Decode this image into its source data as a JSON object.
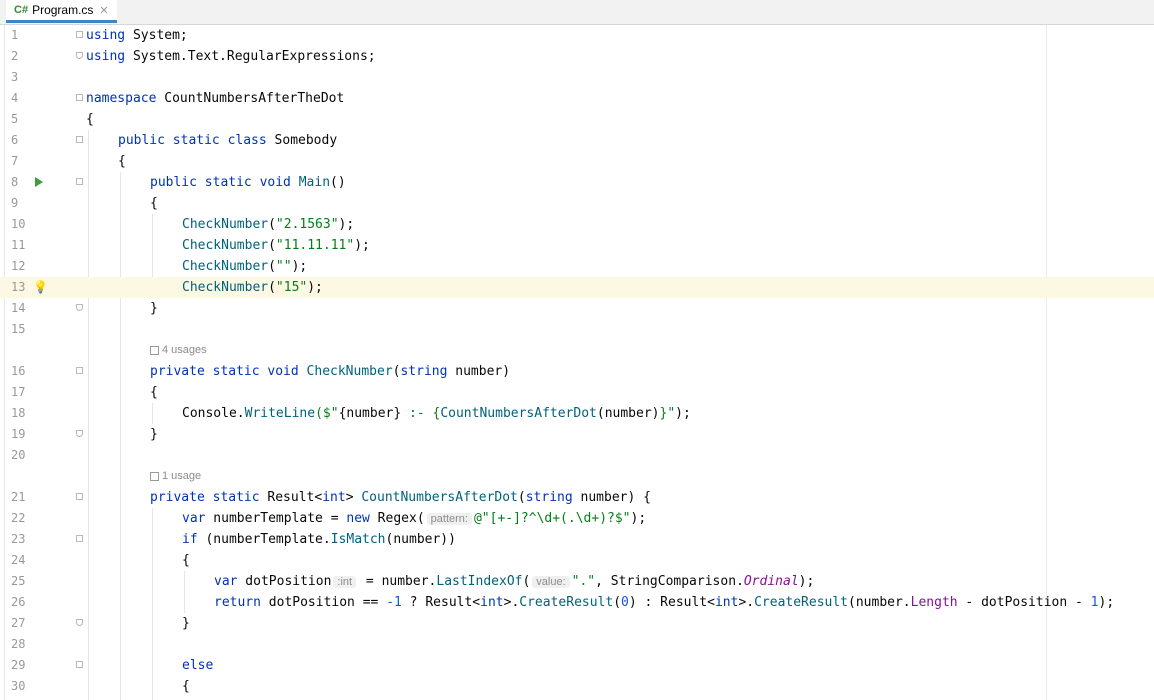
{
  "tab": {
    "lang": "C#",
    "name": "Program.cs",
    "close": "✕"
  },
  "lines": {
    "n1": "1",
    "n2": "2",
    "n3": "3",
    "n4": "4",
    "n5": "5",
    "n6": "6",
    "n7": "7",
    "n8": "8",
    "n9": "9",
    "n10": "10",
    "n11": "11",
    "n12": "12",
    "n13": "13",
    "n14": "14",
    "n15": "15",
    "n16": "16",
    "n17": "17",
    "n18": "18",
    "n19": "19",
    "n20": "20",
    "n21": "21",
    "n22": "22",
    "n23": "23",
    "n24": "24",
    "n25": "25",
    "n26": "26",
    "n27": "27",
    "n28": "28",
    "n29": "29",
    "n30": "30"
  },
  "code": {
    "l1_kw": "using",
    "l1_rest": " System;",
    "l2_kw": "using",
    "l2_rest": " System.Text.RegularExpressions;",
    "l4_kw": "namespace",
    "l4_rest": " CountNumbersAfterTheDot",
    "l5": "{",
    "l6_kw": "public static class",
    "l6_rest": " Somebody",
    "l7": "{",
    "l8_kw": "public static void",
    "l8_m": "Main",
    "l8_rest": "()",
    "l9": "{",
    "l10_m": "CheckNumber",
    "l10_s": "\"2.1563\"",
    "l10_end": ");",
    "l11_m": "CheckNumber",
    "l11_s": "\"11.11.11\"",
    "l11_end": ");",
    "l12_m": "CheckNumber",
    "l12_s": "\"\"",
    "l12_end": ");",
    "l13_m": "CheckNumber",
    "l13_s": "\"15\"",
    "l13_end": ");",
    "l14": "}",
    "usages_a": "4 usages",
    "l16_kw": "private static void",
    "l16_m": "CheckNumber",
    "l16_kw2": "string",
    "l16_rest": " number)",
    "l17": "{",
    "l18_a": "Console.",
    "l18_m": "WriteLine",
    "l18_b": "($\"",
    "l18_c": "{number}",
    "l18_s": " :- ",
    "l18_d": "{",
    "l18_m2": "CountNumbersAfterDot",
    "l18_e": "(number)",
    "l18_f": "}",
    "l18_g": "\"",
    "l18_h": ");",
    "l19": "}",
    "usages_b": "1 usage",
    "l21_kw": "private static",
    "l21_a": " Result<",
    "l21_kw2": "int",
    "l21_b": "> ",
    "l21_m": "CountNumbersAfterDot",
    "l21_c": "(",
    "l21_kw3": "string",
    "l21_d": " number) {",
    "l22_kw": "var",
    "l22_a": " numberTemplate = ",
    "l22_kw2": "new",
    "l22_b": " Regex(",
    "l22_hint": "pattern:",
    "l22_s": "@\"[+-]?^\\d+(.\\d+)?$\"",
    "l22_c": ");",
    "l23_kw": "if",
    "l23_a": " (numberTemplate.",
    "l23_m": "IsMatch",
    "l23_b": "(number))",
    "l24": "{",
    "l25_kw": "var",
    "l25_a": " dotPosition",
    "l25_hint": ":int",
    "l25_b": " = number.",
    "l25_m": "LastIndexOf",
    "l25_c": "(",
    "l25_hint2": "value:",
    "l25_s": "\".\"",
    "l25_d": ", StringComparison.",
    "l25_it": "Ordinal",
    "l25_e": ");",
    "l26_kw": "return",
    "l26_a": " dotPosition == ",
    "l26_n1": "-1",
    "l26_b": " ? Result<",
    "l26_kw2": "int",
    "l26_c": ">.",
    "l26_m": "CreateResult",
    "l26_d": "(",
    "l26_n2": "0",
    "l26_e": ") : Result<",
    "l26_kw3": "int",
    "l26_f": ">.",
    "l26_m2": "CreateResult",
    "l26_g": "(number.",
    "l26_p": "Length",
    "l26_h": " - dotPosition - ",
    "l26_n3": "1",
    "l26_i": ");",
    "l27": "}",
    "l29_kw": "else",
    "l30": "{"
  }
}
